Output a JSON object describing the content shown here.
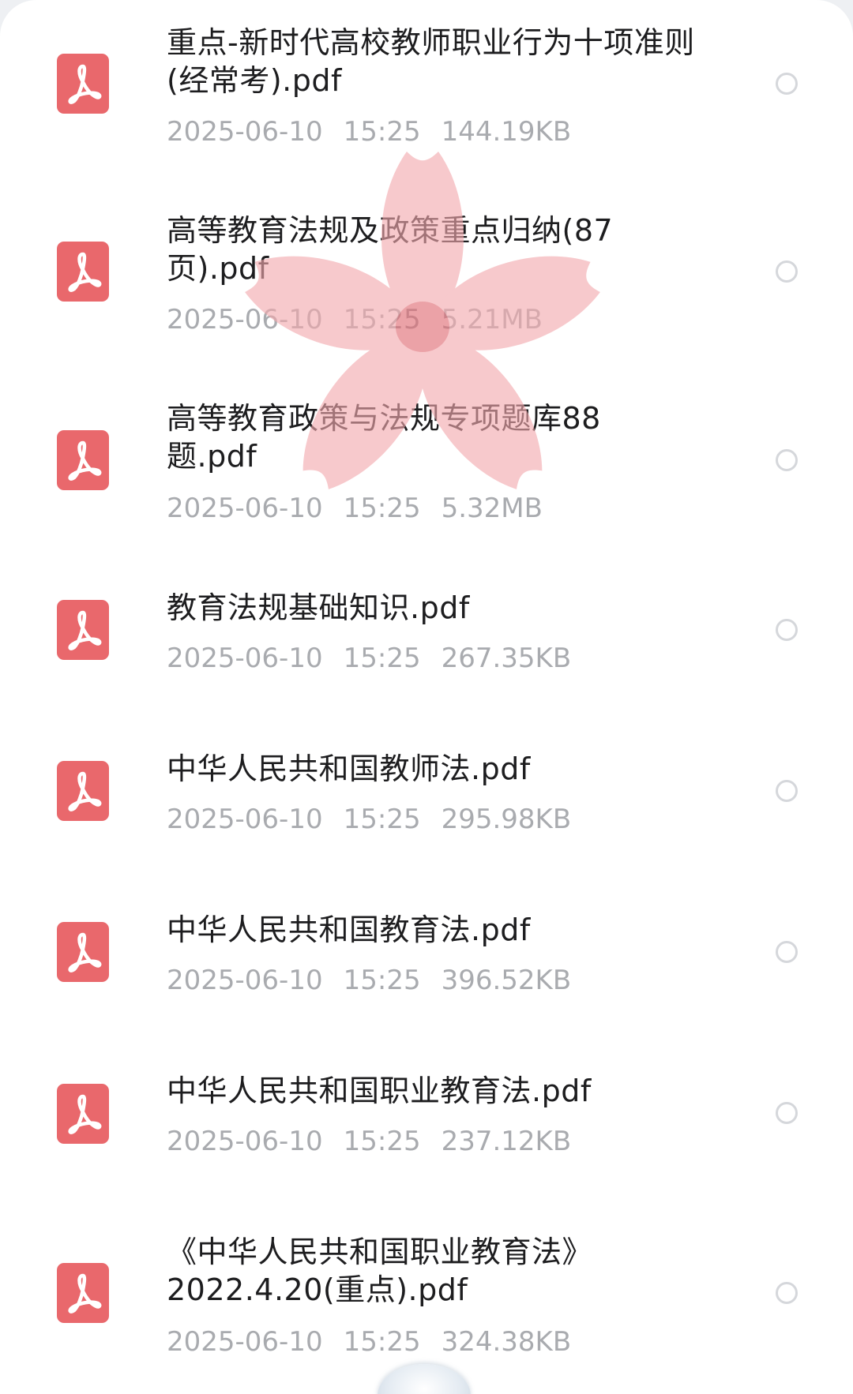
{
  "files": [
    {
      "name": "重点-新时代高校教师职业行为十项准则(经常考).pdf",
      "date": "2025-06-10",
      "time": "15:25",
      "size": "144.19KB"
    },
    {
      "name": "高等教育法规及政策重点归纳(87页).pdf",
      "date": "2025-06-10",
      "time": "15:25",
      "size": "5.21MB"
    },
    {
      "name": "高等教育政策与法规专项题库88题.pdf",
      "date": "2025-06-10",
      "time": "15:25",
      "size": "5.32MB"
    },
    {
      "name": "教育法规基础知识.pdf",
      "date": "2025-06-10",
      "time": "15:25",
      "size": "267.35KB"
    },
    {
      "name": "中华人民共和国教师法.pdf",
      "date": "2025-06-10",
      "time": "15:25",
      "size": "295.98KB"
    },
    {
      "name": "中华人民共和国教育法.pdf",
      "date": "2025-06-10",
      "time": "15:25",
      "size": "396.52KB"
    },
    {
      "name": "中华人民共和国职业教育法.pdf",
      "date": "2025-06-10",
      "time": "15:25",
      "size": "237.12KB"
    },
    {
      "name": "《中华人民共和国职业教育法》2022.4.20(重点).pdf",
      "date": "2025-06-10",
      "time": "15:25",
      "size": "324.38KB"
    }
  ],
  "icons": {
    "file_type": "pdf-icon",
    "selector": "radio-empty-icon",
    "overlay": "flower-sticker"
  },
  "colors": {
    "pdf_icon": "#e9686c",
    "name_text": "#1d1d1f",
    "meta_text": "#a9abaf",
    "radio_border": "#d5d7db",
    "flower": "#f3a9ad",
    "flower_center": "#e06a72"
  }
}
